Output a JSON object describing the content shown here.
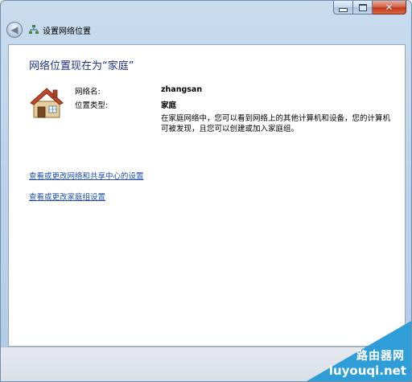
{
  "window": {
    "title": "设置网络位置",
    "close_symbol": "✕"
  },
  "content": {
    "heading": "网络位置现在为“家庭”",
    "network_name_label": "网络名:",
    "network_name_value": "zhangsan",
    "location_type_label": "位置类型:",
    "location_type_value": "家庭",
    "description": "在家庭网络中，您可以看到网络上的其他计算机和设备，您的计算机可被发现，且您可以创建或加入家庭组。",
    "link_network_center": "查看或更改网络和共享中心的设置",
    "link_homegroup": "查看或更改家庭组设置"
  },
  "watermark": {
    "cn": "路由器网",
    "en": "luyouqi.net"
  },
  "colors": {
    "heading": "#1e3287",
    "link": "#1f4ca7",
    "watermark_band": "#2f9ed8"
  }
}
